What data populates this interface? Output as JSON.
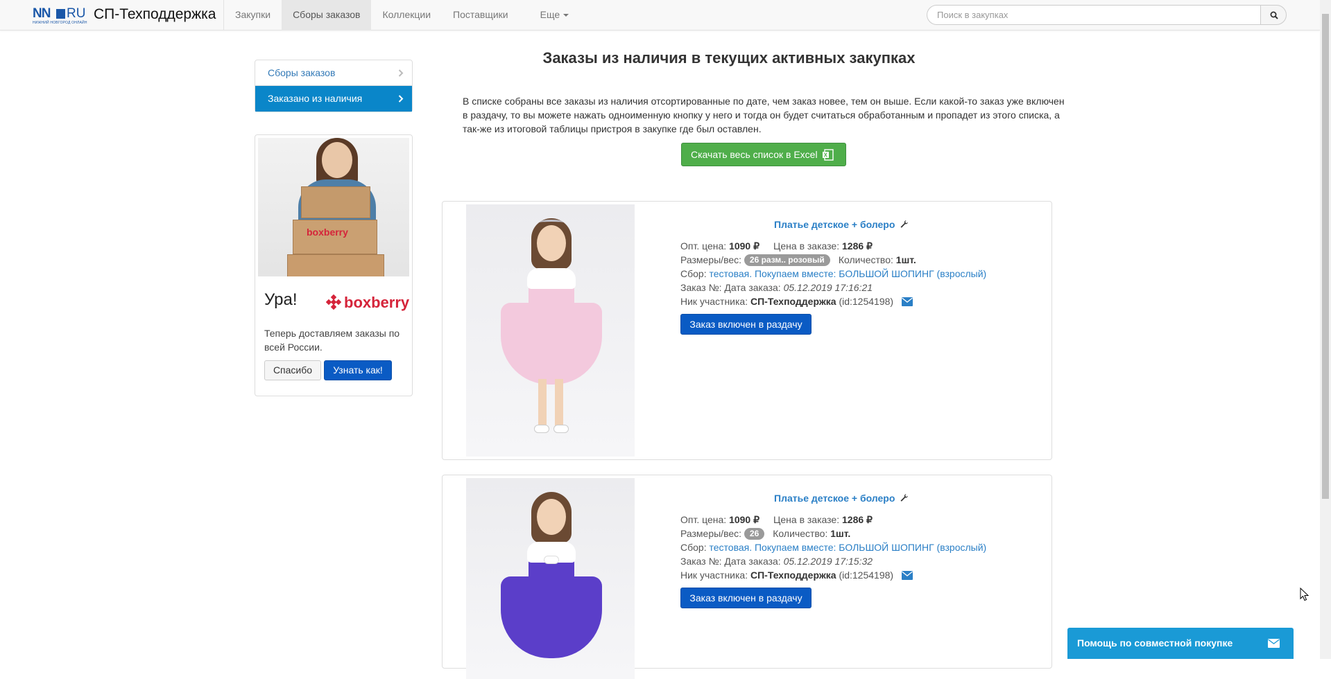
{
  "header": {
    "logo_text": "NN",
    "logo_ru": "RU",
    "logo_sub": "НИЖНИЙ НОВГОРОД ОНЛАЙН",
    "brand": "СП-Техподдержка",
    "nav": [
      {
        "label": "Закупки"
      },
      {
        "label": "Сборы заказов",
        "active": true
      },
      {
        "label": "Коллекции"
      },
      {
        "label": "Поставщики"
      },
      {
        "label": "Еще"
      }
    ],
    "search_placeholder": "Поиск в закупках"
  },
  "sidebar": {
    "items": [
      {
        "label": "Сборы заказов"
      },
      {
        "label": "Заказано из наличия",
        "active": true
      }
    ]
  },
  "promo": {
    "title": "Ура!",
    "brand": "boxberry",
    "image_logo": "boxberry",
    "text": "Теперь доставляем заказы по всей России.",
    "btn_thanks": "Спасибо",
    "btn_learn": "Узнать как!"
  },
  "main": {
    "title": "Заказы из наличия в текущих активных закупках",
    "intro": "В списке собраны все заказы из наличия отсортированные по дате, чем заказ новее, тем он выше. Если какой-то заказ уже включен в раздачу, то вы можете нажать одноименную кнопку у него и тогда он будет считаться обработанным и пропадет из этого списка, а так-же из итоговой таблицы пристроя в закупке где был оставлен.",
    "excel_button": "Скачать весь список в Excel"
  },
  "labels": {
    "opt_price": "Опт. цена:",
    "order_price": "Цена в заказе:",
    "sizes": "Размеры/вес:",
    "quantity": "Количество:",
    "collection": "Сбор:",
    "order_no": "Заказ №:",
    "order_date": "Дата заказа:",
    "nick": "Ник участника:",
    "done_button": "Заказ включен в раздачу"
  },
  "orders": [
    {
      "title": "Платье детское + болеро",
      "opt_price": "1090 ₽",
      "order_price": "1286 ₽",
      "size": "26 разм.. розовый",
      "quantity": "1шт.",
      "collection": "тестовая. Покупаем вместе: БОЛЬШОЙ ШОПИНГ (взрослый)",
      "date": "05.12.2019 17:16:21",
      "nick": "СП-Техподдержка",
      "user_id": "(id:1254198)",
      "dress_color": "#f3c9dd"
    },
    {
      "title": "Платье детское + болеро",
      "opt_price": "1090 ₽",
      "order_price": "1286 ₽",
      "size": "26",
      "quantity": "1шт.",
      "collection": "тестовая. Покупаем вместе: БОЛЬШОЙ ШОПИНГ (взрослый)",
      "date": "05.12.2019 17:15:32",
      "nick": "СП-Техподдержка",
      "user_id": "(id:1254198)",
      "dress_color": "#5b3ec9"
    }
  ],
  "help_widget": {
    "label": "Помощь по совместной покупке"
  },
  "icons": {
    "search": "search-icon",
    "chevron": "chevron-right-icon",
    "wrench": "wrench-icon",
    "mail": "envelope-icon",
    "excel": "excel-icon"
  }
}
